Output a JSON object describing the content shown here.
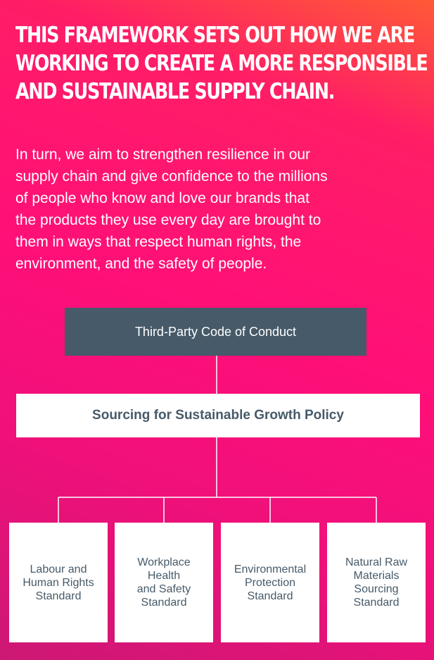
{
  "headline": [
    "THIS FRAMEWORK SETS OUT HOW WE ARE",
    "WORKING TO CREATE A MORE RESPONSIBLE",
    "AND SUSTAINABLE SUPPLY CHAIN."
  ],
  "intro": [
    "In turn, we aim to strengthen resilience in our",
    "supply chain and give confidence to the millions",
    "of people who know and love our brands that",
    "the products they use every day are brought to",
    "them in ways that respect human rights, the",
    "environment, and the safety of people."
  ],
  "diagram": {
    "top": "Third-Party Code of Conduct",
    "middle": "Sourcing for Sustainable Growth Policy",
    "standards": [
      "Labour and\nHuman Rights\nStandard",
      "Workplace\nHealth\nand Safety\nStandard",
      "Environmental\nProtection\nStandard",
      "Natural Raw\nMaterials\nSourcing\nStandard"
    ]
  },
  "colors": {
    "background_accent": "#ff0f78",
    "dark_box": "#465a69",
    "light_box": "#ffffff",
    "text_on_light": "#465a69"
  }
}
